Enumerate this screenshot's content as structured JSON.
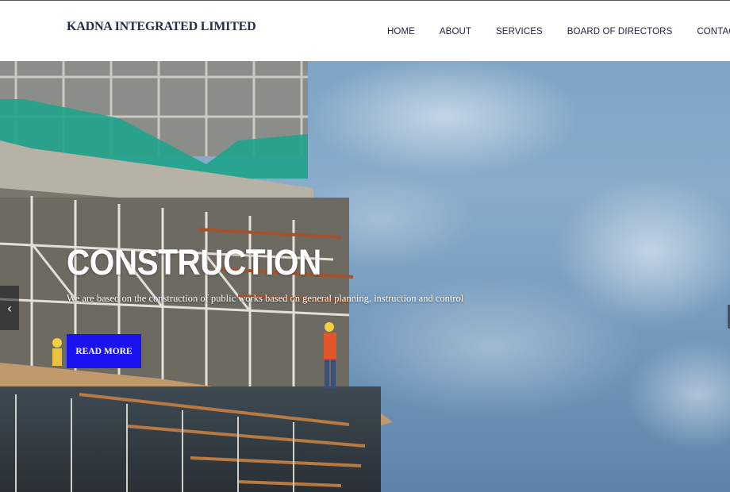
{
  "header": {
    "brand": "KADNA INTEGRATED LIMITED",
    "nav": [
      {
        "label": "HOME"
      },
      {
        "label": "ABOUT"
      },
      {
        "label": "SERVICES"
      },
      {
        "label": "BOARD OF DIRECTORS"
      },
      {
        "label": "CONTACT"
      }
    ]
  },
  "hero": {
    "title": "CONSTRUCTION",
    "subtitle": "We are based on the construction of public works based on general planning, instruction and control",
    "cta_label": "READ MORE",
    "prev_arrow": "‹",
    "image": "construction-site-scaffolding-with-worker"
  },
  "colors": {
    "brand_text": "#1f2f4a",
    "cta_background": "#1a12ef",
    "sky": "#7ea5c6"
  }
}
